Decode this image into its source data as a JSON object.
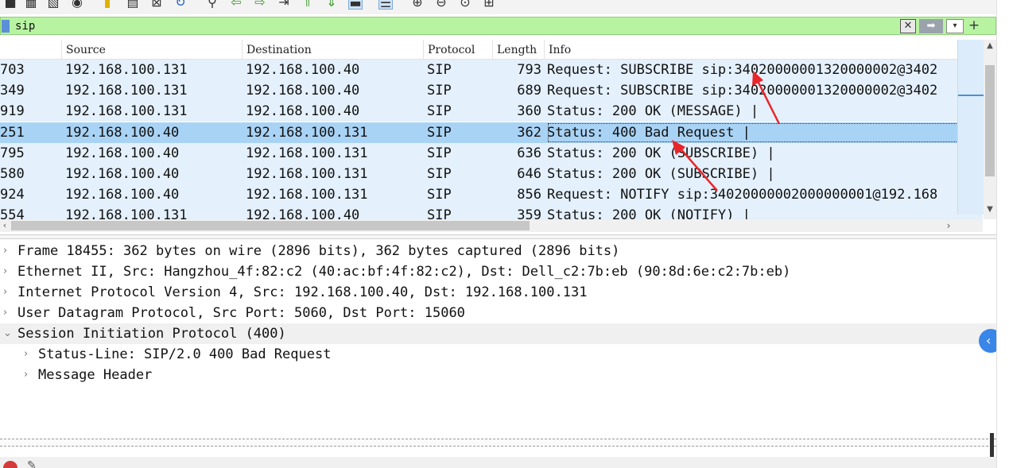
{
  "filter": {
    "value": "sip"
  },
  "packet_list": {
    "columns": [
      "Source",
      "Destination",
      "Protocol",
      "Length",
      "Info"
    ],
    "rows": [
      {
        "no": "703",
        "src": "192.168.100.131",
        "dst": "192.168.100.40",
        "proto": "SIP",
        "len": "793",
        "info": "Request: SUBSCRIBE sip:34020000001320000002@3402"
      },
      {
        "no": "349",
        "src": "192.168.100.131",
        "dst": "192.168.100.40",
        "proto": "SIP",
        "len": "689",
        "info": "Request: SUBSCRIBE sip:34020000001320000002@3402"
      },
      {
        "no": "919",
        "src": "192.168.100.131",
        "dst": "192.168.100.40",
        "proto": "SIP",
        "len": "360",
        "info": "Status: 200 OK (MESSAGE) |"
      },
      {
        "no": "251",
        "src": "192.168.100.40",
        "dst": "192.168.100.131",
        "proto": "SIP",
        "len": "362",
        "info": "Status: 400 Bad Request |"
      },
      {
        "no": "795",
        "src": "192.168.100.40",
        "dst": "192.168.100.131",
        "proto": "SIP",
        "len": "636",
        "info": "Status: 200 OK (SUBSCRIBE) |"
      },
      {
        "no": "580",
        "src": "192.168.100.40",
        "dst": "192.168.100.131",
        "proto": "SIP",
        "len": "646",
        "info": "Status: 200 OK (SUBSCRIBE) |"
      },
      {
        "no": "924",
        "src": "192.168.100.40",
        "dst": "192.168.100.131",
        "proto": "SIP",
        "len": "856",
        "info": "Request: NOTIFY sip:34020000002000000001@192.168"
      },
      {
        "no": "554",
        "src": "192.168.100.131",
        "dst": "192.168.100.40",
        "proto": "SIP",
        "len": "359",
        "info": "Status: 200 OK (NOTIFY) |"
      }
    ],
    "selected_index": 3
  },
  "details": {
    "rows": [
      {
        "arrow": "›",
        "text": "Frame 18455: 362 bytes on wire (2896 bits), 362 bytes captured (2896 bits)"
      },
      {
        "arrow": "›",
        "text": "Ethernet II, Src: Hangzhou_4f:82:c2 (40:ac:bf:4f:82:c2), Dst: Dell_c2:7b:eb (90:8d:6e:c2:7b:eb)"
      },
      {
        "arrow": "›",
        "text": "Internet Protocol Version 4, Src: 192.168.100.40, Dst: 192.168.100.131"
      },
      {
        "arrow": "›",
        "text": "User Datagram Protocol, Src Port: 5060, Dst Port: 15060"
      },
      {
        "arrow": "⌄",
        "text": "Session Initiation Protocol (400)"
      },
      {
        "arrow": "›",
        "text": "Status-Line: SIP/2.0 400 Bad Request"
      },
      {
        "arrow": "›",
        "text": "Message Header"
      }
    ]
  },
  "icons": {
    "toolbar": [
      "stop-capture-icon",
      "close-file-icon",
      "reload-icon",
      "find-packet-icon",
      "go-back-icon",
      "go-forward-icon",
      "go-to-packet-icon",
      "first-packet-icon",
      "last-packet-icon",
      "auto-scroll-icon",
      "colorize-icon",
      "zoom-in-icon",
      "zoom-out-icon",
      "normal-size-icon",
      "resize-columns-icon"
    ],
    "annotation_color": "#e8262a"
  },
  "colors": {
    "row_bg": "#e4f0fb",
    "row_selected_bg": "#a9d3f5",
    "filter_bg": "#b7f3a1"
  }
}
